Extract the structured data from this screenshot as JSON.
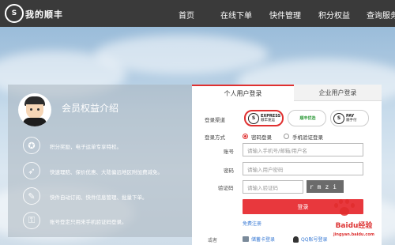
{
  "header": {
    "logo": "S",
    "brand": "我的顺丰",
    "nav": [
      "首页",
      "在线下单",
      "快件管理",
      "积分权益",
      "查询服务"
    ]
  },
  "left_panel": {
    "title": "会员权益介绍",
    "benefits": [
      {
        "icon": "medal-icon",
        "text": "积分奖励，电子运单专享特权。"
      },
      {
        "icon": "rocket-icon",
        "text": "快速理赔、保价优惠、大陆偏远地区附加费减免。"
      },
      {
        "icon": "bird-icon",
        "text": "快件自动订阅、快件信息管理、批量下单。"
      },
      {
        "icon": "lock-icon",
        "text": "账号登定只用来手机验证码登录。"
      }
    ]
  },
  "login": {
    "tabs": [
      "个人用户登录",
      "企业用户登录"
    ],
    "channel_label": "登录渠道",
    "channels": [
      {
        "name": "EXPRESS",
        "sub": "顺丰速运"
      },
      {
        "name": "顺丰优选",
        "sub": ""
      },
      {
        "name": "PAY",
        "sub": "顺手付"
      }
    ],
    "method_label": "登录方式",
    "methods": [
      "密码登录",
      "手机验证登录"
    ],
    "account_label": "账号",
    "account_placeholder": "请输入手机号/邮箱/用户名",
    "password_label": "密码",
    "password_placeholder": "请输入用户密码",
    "captcha_label": "验证码",
    "captcha_placeholder": "请输入验证码",
    "captcha_text": "rmzi",
    "login_button": "登录",
    "register_link": "免费注册",
    "other_label": "或者",
    "alt_logins": [
      "储蓄卡登录",
      "QQ账号登录"
    ]
  },
  "watermark": {
    "text": "Baidu经验",
    "sub": "jingyan.baidu.com"
  },
  "colors": {
    "nav_bg": "#3a3a3a",
    "accent_red": "#e8383d",
    "link_blue": "#3a7bd5"
  }
}
